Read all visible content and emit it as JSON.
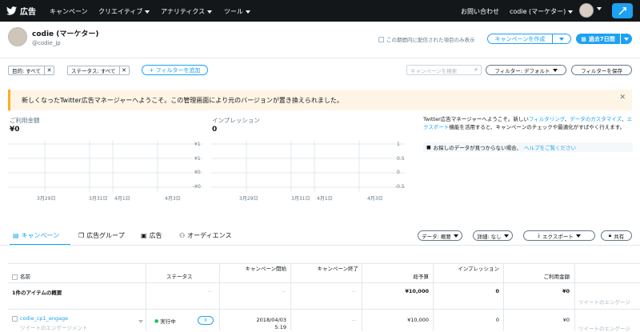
{
  "nav": {
    "brand": "広告",
    "items": [
      "キャンペーン",
      "クリエイティブ",
      "アナリティクス",
      "ツール"
    ],
    "contact": "お問い合わせ",
    "account_menu": "codie (マーケター)"
  },
  "account": {
    "name": "codie (マーケター)",
    "handle": "@codie_jp"
  },
  "header": {
    "only_delivered_label": "この期間内に配信された項目のみ表示",
    "create_campaign": "キャンペーンを作成",
    "date_range": "過去7日間"
  },
  "filters": {
    "objective": "目的: すべて",
    "status": "ステータス: すべて",
    "add_filter": "+ フィルターを追加",
    "search_placeholder": "キャンペーンを検索",
    "default_filter": "フィルター: デフォルト",
    "save_filter": "フィルターを保存"
  },
  "banner": {
    "text": "新しくなったTwitter広告マネージャーへようこそ。この管理画面により元のバージョンが置き換えられました。"
  },
  "metrics": {
    "spend_label": "ご利用金額",
    "spend_value": "¥0",
    "impressions_label": "インプレッション",
    "impressions_value": "0"
  },
  "spend_chart": {
    "y_ticks": [
      "¥1",
      "¥1",
      "¥0",
      "-¥0"
    ],
    "x_ticks": [
      "3月29日",
      "3月31日",
      "4月1日",
      "4月3日"
    ]
  },
  "imp_chart": {
    "y_ticks": [
      "1",
      "0.5",
      "0",
      "-0.5"
    ],
    "x_ticks": [
      "3月29日",
      "3月31日",
      "4月1日",
      "4月3日"
    ]
  },
  "chart_data": [
    {
      "type": "line",
      "title": "ご利用金額",
      "x": [
        "3月29日",
        "3月31日",
        "4月1日",
        "4月3日"
      ],
      "series": [
        {
          "values": [
            0,
            0,
            0,
            0
          ]
        }
      ]
    },
    {
      "type": "line",
      "title": "インプレッション",
      "x": [
        "3月29日",
        "3月31日",
        "4月1日",
        "4月3日"
      ],
      "series": [
        {
          "values": [
            0,
            0,
            0,
            0
          ]
        }
      ]
    }
  ],
  "side": {
    "welcome_1": "Twitter広告マネージャーへようこそ。新しい",
    "link_filtering": "フィルタリング",
    "sep1": "、",
    "link_custom": "データのカスタマイズ",
    "sep2": "、",
    "link_export": "エクスポート",
    "welcome_2": "機能を活用すると、キャンペーンのチェックや最適化がすばやく行えます。",
    "help_text": "お探しのデータが見つからない場合、",
    "help_link": "ヘルプをご覧ください"
  },
  "tabs": {
    "campaigns": "キャンペーン",
    "ad_groups": "広告グループ",
    "ads": "広告",
    "audiences": "オーディエンス"
  },
  "tab_actions": {
    "data": "データ: 概要",
    "details": "詳細: なし",
    "export": "エクスポート",
    "share": "共有"
  },
  "table": {
    "headers": {
      "name": "名前",
      "status": "ステータス",
      "start": "キャンペーン開始",
      "end": "キャンペーン終了",
      "budget": "総予算",
      "impressions": "インプレッション",
      "spend": "ご利用金額"
    },
    "summary": {
      "label": "1件のアイテムの概要",
      "status": "--",
      "start": "--",
      "end": "--",
      "budget": "¥10,000",
      "impressions": "0",
      "spend": "¥0",
      "sub": "ツイートのエンゲージ"
    },
    "row": {
      "name": "codie_cp1_engage",
      "objective": "ツイートのエンゲージメント",
      "status": "実行中",
      "start": "2018/04/03",
      "start_time": "5:19",
      "end": "--",
      "budget": "¥10,000",
      "impressions": "0",
      "spend": "¥0",
      "sub": "ツイートのエンゲージ"
    }
  }
}
